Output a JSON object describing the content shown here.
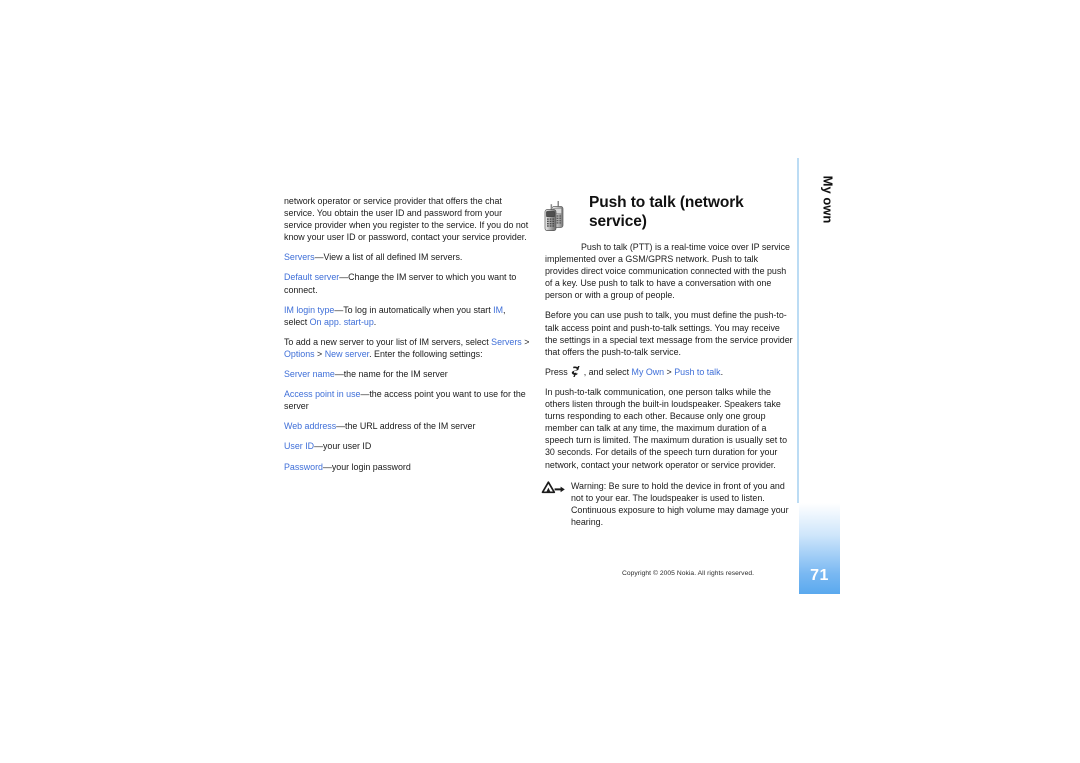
{
  "page": {
    "number": "71",
    "side_tab_label": "My own",
    "copyright": "Copyright © 2005 Nokia. All rights reserved."
  },
  "left_column": {
    "paragraphs": [
      {
        "id": "intro",
        "text": "network operator or service provider that offers the chat service. You obtain the user ID and password from your service provider when you register to the service. If you do not know your user ID or password, contact your service provider."
      },
      {
        "id": "servers",
        "term": "Servers",
        "text": "—View a list of all defined IM servers."
      },
      {
        "id": "default-server",
        "term": "Default server",
        "text": "—Change the IM server to which you want to connect."
      },
      {
        "id": "im-login-type",
        "term": "IM login type",
        "text_a": "—To log in automatically when you start ",
        "term_b": "IM",
        "text_b": ", select ",
        "term_c": "On app. start-up",
        "text_c": "."
      },
      {
        "id": "add-server",
        "text_a": "To add a new server to your list of IM servers, select ",
        "term_a": "Servers",
        "sep_a": " > ",
        "term_b": "Options",
        "sep_b": " > ",
        "term_c": "New server",
        "text_b": ". Enter the following settings:"
      },
      {
        "id": "server-name",
        "term": "Server name",
        "text": "—the name for the IM server"
      },
      {
        "id": "access-point",
        "term": "Access point in use",
        "text": "—the access point you want to use for the server"
      },
      {
        "id": "web-address",
        "term": "Web address",
        "text": "—the URL address of the IM server"
      },
      {
        "id": "user-id",
        "term": "User ID",
        "text": "—your user ID"
      },
      {
        "id": "password",
        "term": "Password",
        "text": "—your login password"
      }
    ]
  },
  "right_column": {
    "heading": "Push to talk (network service)",
    "heading_icon": "two-phones-icon",
    "lead": "Push to talk (PTT) is a real-time voice over IP service implemented over a GSM/GPRS network. Push to talk provides direct voice communication connected with the push of a key. Use push to talk to have a conversation with one person or with a group of people.",
    "para_before": "Before you can use push to talk, you must define the push-to-talk access point and push-to-talk settings. You may receive the settings in a special text message from the service provider that offers the push-to-talk service.",
    "press_line": {
      "prefix": "Press",
      "key_icon": "nokia-menu-key-icon",
      "middle": ", and select ",
      "term_a": "My Own",
      "sep": " > ",
      "term_b": "Push to talk",
      "suffix": "."
    },
    "para_comm": "In push-to-talk communication, one person talks while the others listen through the built-in loudspeaker. Speakers take turns responding to each other. Because only one group member can talk at any time, the maximum duration of a speech turn is limited. The maximum duration is usually set to 30 seconds. For details of the speech turn duration for your network, contact your network operator or service provider.",
    "warning": {
      "icon": "warning-triangle-icon",
      "text": "Warning: Be sure to hold the device in front of you and not to your ear. The loudspeaker is used to listen. Continuous exposure to high volume may damage your hearing."
    }
  },
  "colors": {
    "link_blue": "#3f6fd8",
    "tab_blue": "#5aa9ee",
    "rule_blue": "#bcdcf4",
    "text": "#1c1c1c"
  }
}
